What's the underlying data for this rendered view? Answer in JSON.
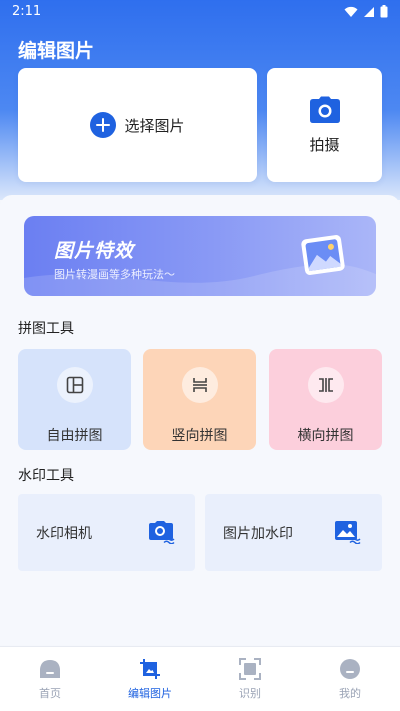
{
  "status_bar": {
    "time": "2:11"
  },
  "header": {
    "title": "编辑图片"
  },
  "actions": {
    "select_label": "选择图片",
    "shoot_label": "拍摄"
  },
  "banner": {
    "title": "图片特效",
    "subtitle": "图片转漫画等多种玩法～"
  },
  "collage": {
    "title": "拼图工具",
    "items": [
      {
        "label": "自由拼图",
        "bg": "#d6e3fb",
        "icon": "free-collage-icon"
      },
      {
        "label": "竖向拼图",
        "bg": "#fdd5b8",
        "icon": "vertical-collage-icon"
      },
      {
        "label": "横向拼图",
        "bg": "#fccfdc",
        "icon": "horizontal-collage-icon"
      }
    ]
  },
  "watermark": {
    "title": "水印工具",
    "items": [
      {
        "label": "水印相机",
        "icon": "watermark-camera-icon"
      },
      {
        "label": "图片加水印",
        "icon": "image-watermark-icon"
      }
    ]
  },
  "nav": {
    "items": [
      {
        "label": "首页",
        "icon": "home-icon",
        "active": false
      },
      {
        "label": "编辑图片",
        "icon": "crop-icon",
        "active": true
      },
      {
        "label": "识别",
        "icon": "scan-icon",
        "active": false
      },
      {
        "label": "我的",
        "icon": "profile-icon",
        "active": false
      }
    ]
  },
  "colors": {
    "primary": "#1f62e0",
    "header_gradient_top": "#2f6fee",
    "nav_inactive": "#9aa3b5"
  }
}
